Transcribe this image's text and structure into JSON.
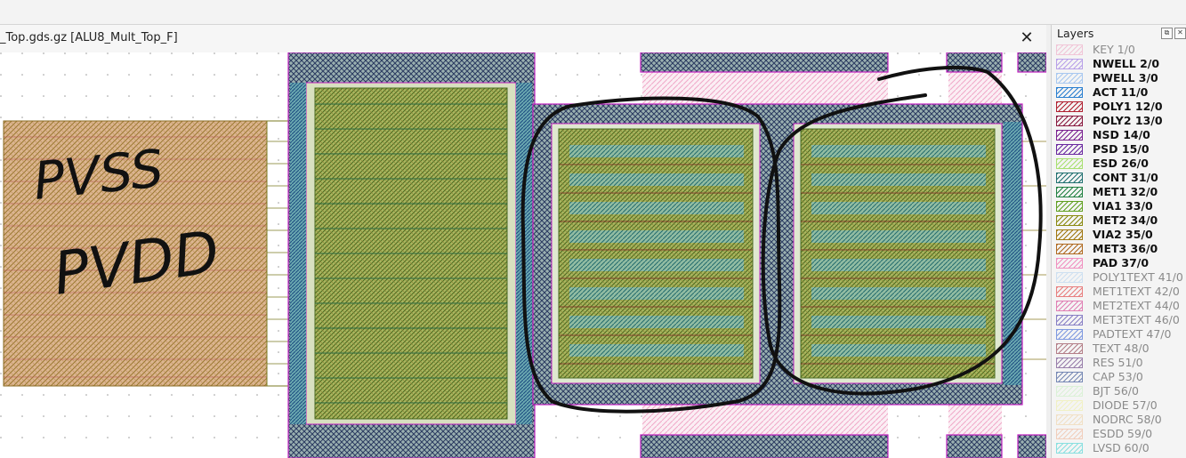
{
  "window": {
    "tab_title": "_Top.gds.gz [ALU8_Mult_Top_F]",
    "close_label": "✕"
  },
  "layers_panel": {
    "title": "Layers",
    "float_label": "⧉",
    "close_label": "✕",
    "items": [
      {
        "name": "KEY 1/0",
        "active": false,
        "color": "#f0a0c0"
      },
      {
        "name": "NWELL 2/0",
        "active": true,
        "color": "#b8a0e8"
      },
      {
        "name": "PWELL 3/0",
        "active": true,
        "color": "#a8c8f0"
      },
      {
        "name": "ACT 11/0",
        "active": true,
        "color": "#2a7fd0"
      },
      {
        "name": "POLY1 12/0",
        "active": true,
        "color": "#b02030"
      },
      {
        "name": "POLY2 13/0",
        "active": true,
        "color": "#8a1a40"
      },
      {
        "name": "NSD 14/0",
        "active": true,
        "color": "#7a2090"
      },
      {
        "name": "PSD 15/0",
        "active": true,
        "color": "#6a28a0"
      },
      {
        "name": "ESD 26/0",
        "active": true,
        "color": "#a8e070"
      },
      {
        "name": "CONT 31/0",
        "active": true,
        "color": "#207070"
      },
      {
        "name": "MET1 32/0",
        "active": true,
        "color": "#208040"
      },
      {
        "name": "VIA1 33/0",
        "active": true,
        "color": "#60a020"
      },
      {
        "name": "MET2 34/0",
        "active": true,
        "color": "#8a8a10"
      },
      {
        "name": "VIA2 35/0",
        "active": true,
        "color": "#a07810"
      },
      {
        "name": "MET3 36/0",
        "active": true,
        "color": "#b06a20"
      },
      {
        "name": "PAD 37/0",
        "active": true,
        "color": "#f090c0"
      },
      {
        "name": "POLY1TEXT 41/0",
        "active": false,
        "color": "#b0d0f0"
      },
      {
        "name": "MET1TEXT 42/0",
        "active": false,
        "color": "#e02020"
      },
      {
        "name": "MET2TEXT 44/0",
        "active": false,
        "color": "#d02080"
      },
      {
        "name": "MET3TEXT 46/0",
        "active": false,
        "color": "#3020a0"
      },
      {
        "name": "PADTEXT 47/0",
        "active": false,
        "color": "#2050d0"
      },
      {
        "name": "TEXT 48/0",
        "active": false,
        "color": "#802030"
      },
      {
        "name": "RES 51/0",
        "active": false,
        "color": "#502070"
      },
      {
        "name": "CAP 53/0",
        "active": false,
        "color": "#103080"
      },
      {
        "name": "BJT 56/0",
        "active": false,
        "color": "#c8f0c0"
      },
      {
        "name": "DIODE 57/0",
        "active": false,
        "color": "#f0f0a0"
      },
      {
        "name": "NODRC 58/0",
        "active": false,
        "color": "#f0d0a0"
      },
      {
        "name": "ESDD 59/0",
        "active": false,
        "color": "#f0b090"
      },
      {
        "name": "LVSD 60/0",
        "active": false,
        "color": "#30d0d0"
      }
    ]
  },
  "layout_view": {
    "handwritten_notes": [
      "PVSS",
      "PVDD"
    ],
    "colors": {
      "pad_fill": "#d8b088",
      "metal_green": "#7a9a30",
      "active_teal": "#2a8a8a",
      "cross_hatch": "#3a4a7a",
      "nwell_pink": "#f0b0d0",
      "outline_magenta": "#c020c0",
      "ink": "#111111"
    }
  }
}
